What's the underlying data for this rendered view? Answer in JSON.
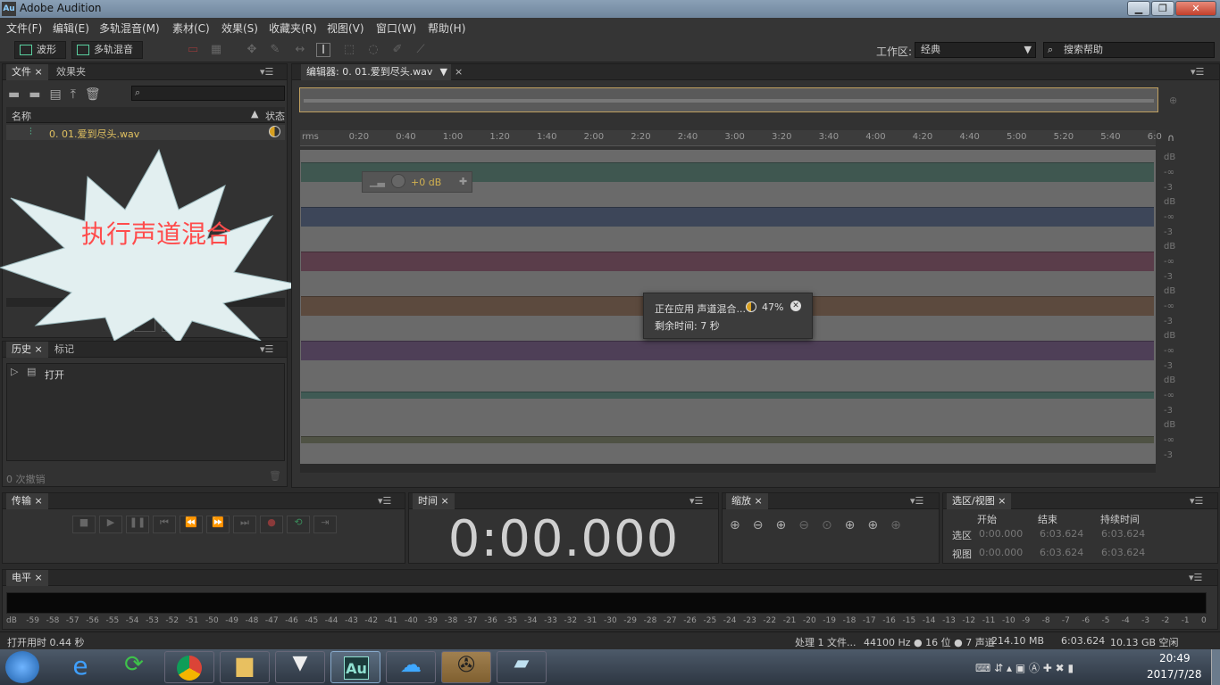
{
  "window": {
    "title": "Adobe Audition",
    "app_icon": "Au"
  },
  "menu": [
    "文件(F)",
    "编辑(E)",
    "多轨混音(M)",
    "素材(C)",
    "效果(S)",
    "收藏夹(R)",
    "视图(V)",
    "窗口(W)",
    "帮助(H)"
  ],
  "toolbar": {
    "waveform_label": "波形",
    "multitrack_label": "多轨混音",
    "workspace_label": "工作区:",
    "workspace_value": "经典",
    "search_placeholder": "搜索帮助"
  },
  "files_panel": {
    "tabs": [
      "文件",
      "效果夹"
    ],
    "col_name": "名称",
    "col_status": "状态",
    "file_name": "0. 01.爱到尽头.wav"
  },
  "callout": {
    "text": "执行声道混合"
  },
  "history_panel": {
    "tabs": [
      "历史",
      "标记"
    ],
    "item": "打开",
    "undo_count": "0 次撤销"
  },
  "editor": {
    "tab_label": "编辑器: 0. 01.爱到尽头.wav",
    "ruler": [
      "rms",
      "0:20",
      "0:40",
      "1:00",
      "1:20",
      "1:40",
      "2:00",
      "2:20",
      "2:40",
      "3:00",
      "3:20",
      "3:40",
      "4:00",
      "4:20",
      "4:40",
      "5:00",
      "5:20",
      "5:40",
      "6:0"
    ],
    "hud_gain": "+0 dB",
    "db_labels": [
      "dB",
      "-∞",
      "-3"
    ],
    "progress_line1": "正在应用 声道混合...",
    "progress_percent": "47%",
    "progress_line2": "剩余时间: 7 秒",
    "progress_fraction": 0.47,
    "track_colors": [
      "#3f5750",
      "#3d4659",
      "#5a3d4a",
      "#5c4a3e",
      "#4e3f57",
      "#3f5a54",
      "#4f5244"
    ]
  },
  "transport_panel": {
    "title": "传输"
  },
  "time_panel": {
    "title": "时间",
    "timecode": "0:00.000"
  },
  "zoom_panel": {
    "title": "缩放"
  },
  "selection_panel": {
    "title": "选区/视图",
    "headers": [
      "开始",
      "结束",
      "持续时间"
    ],
    "rows": [
      {
        "label": "选区",
        "start": "0:00.000",
        "end": "6:03.624",
        "duration": "6:03.624"
      },
      {
        "label": "视图",
        "start": "0:00.000",
        "end": "6:03.624",
        "duration": "6:03.624"
      }
    ]
  },
  "level_panel": {
    "title": "电平",
    "ticks": [
      "dB",
      "-59",
      "-58",
      "-57",
      "-56",
      "-55",
      "-54",
      "-53",
      "-52",
      "-51",
      "-50",
      "-49",
      "-48",
      "-47",
      "-46",
      "-45",
      "-44",
      "-43",
      "-42",
      "-41",
      "-40",
      "-39",
      "-38",
      "-37",
      "-36",
      "-35",
      "-34",
      "-33",
      "-32",
      "-31",
      "-30",
      "-29",
      "-28",
      "-27",
      "-26",
      "-25",
      "-24",
      "-23",
      "-22",
      "-21",
      "-20",
      "-19",
      "-18",
      "-17",
      "-16",
      "-15",
      "-14",
      "-13",
      "-12",
      "-11",
      "-10",
      "-9",
      "-8",
      "-7",
      "-6",
      "-5",
      "-4",
      "-3",
      "-2",
      "-1",
      "0"
    ]
  },
  "status": {
    "left": "打开用时 0.44 秒",
    "processing": "处理 1 文件...",
    "format": "44100 Hz ● 16 位 ● 7 声道",
    "size": "214.10 MB",
    "duration": "6:03.624",
    "free": "10.13 GB 空闲"
  },
  "taskbar": {
    "time": "20:49",
    "date": "2017/7/28",
    "au_label": "Au"
  }
}
